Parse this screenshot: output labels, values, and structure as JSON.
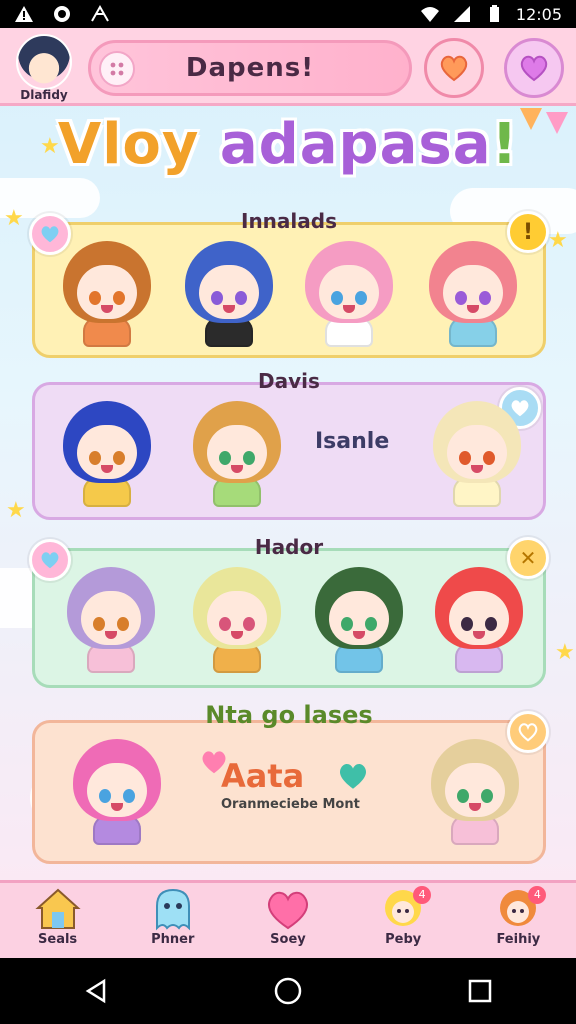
{
  "status_bar": {
    "time": "12:05",
    "left_icons": [
      "alert-icon",
      "sync-icon",
      "signal-icon"
    ],
    "right_icons": [
      "wifi-icon",
      "cell-signal-icon",
      "battery-icon"
    ]
  },
  "header": {
    "profile_label": "Dlafidy",
    "title": "Dapens!",
    "menu_icon": "dots-icon",
    "heart_buttons": [
      "orange-heart-icon",
      "purple-heart-icon"
    ]
  },
  "big_title": {
    "part1": "Vloy ",
    "part2": "adapasa",
    "part3": "!"
  },
  "panels": [
    {
      "title": "Innalads",
      "badge_left": "heart-icon",
      "badge_right": "!",
      "characters": [
        {
          "hair": "#c9742f",
          "body": "#f08a4c",
          "eyes": "#e2752b"
        },
        {
          "hair": "#3f63c9",
          "body": "#2b2b2b",
          "eyes": "#8a5bd8"
        },
        {
          "hair": "#f59cc3",
          "body": "#ffffff",
          "eyes": "#4aa3e0"
        },
        {
          "hair": "#f2838f",
          "body": "#86d0e8",
          "eyes": "#9a5bd8"
        }
      ]
    },
    {
      "title": "Davis",
      "middle_label": "Isanle",
      "badge_right": "hearts-icon",
      "characters": [
        {
          "hair": "#2d47c2",
          "body": "#f5c94a",
          "eyes": "#d87e2b"
        },
        {
          "hair": "#e0a14a",
          "body": "#a6db7a",
          "eyes": "#3fa86a"
        },
        {
          "hair": "#f4e6b8",
          "body": "#fff5c6",
          "eyes": "#e05a2b"
        }
      ]
    },
    {
      "title": "Hador",
      "badge_left": "heart-icon",
      "badge_right": "✕",
      "characters": [
        {
          "hair": "#b49ad9",
          "body": "#f7c0d8",
          "eyes": "#d87e2b"
        },
        {
          "hair": "#e9e69a",
          "body": "#f0b04a",
          "eyes": "#d8557a"
        },
        {
          "hair": "#3a6a3a",
          "body": "#72c4e8",
          "eyes": "#3fa86a"
        },
        {
          "hair": "#ef4a4a",
          "body": "#d8b8f0",
          "eyes": "#3c2a44"
        }
      ]
    },
    {
      "title": "Nta go lases",
      "badge_right": "heart-outline-icon",
      "middle_title": "Aata",
      "middle_sub": "Oranmeciebe Mont",
      "characters": [
        {
          "hair": "#ef6bb6",
          "body": "#b48ae0",
          "eyes": "#4aa3e0"
        },
        {
          "hair": "#e5cf9c",
          "body": "#f7c0d8",
          "eyes": "#3fa86a"
        }
      ]
    }
  ],
  "tabs": [
    {
      "label": "Seals",
      "icon": "house-icon",
      "notif": ""
    },
    {
      "label": "Phner",
      "icon": "ghost-icon",
      "notif": ""
    },
    {
      "label": "Soey",
      "icon": "heart-chat-icon",
      "notif": ""
    },
    {
      "label": "Peby",
      "icon": "character-icon",
      "notif": "4"
    },
    {
      "label": "Feihiy",
      "icon": "character2-icon",
      "notif": "4"
    }
  ],
  "nav": [
    "back-icon",
    "home-icon",
    "recents-icon"
  ],
  "colors": {
    "accent_pink": "#f49abb",
    "tab_bar": "#fcd1e2"
  }
}
